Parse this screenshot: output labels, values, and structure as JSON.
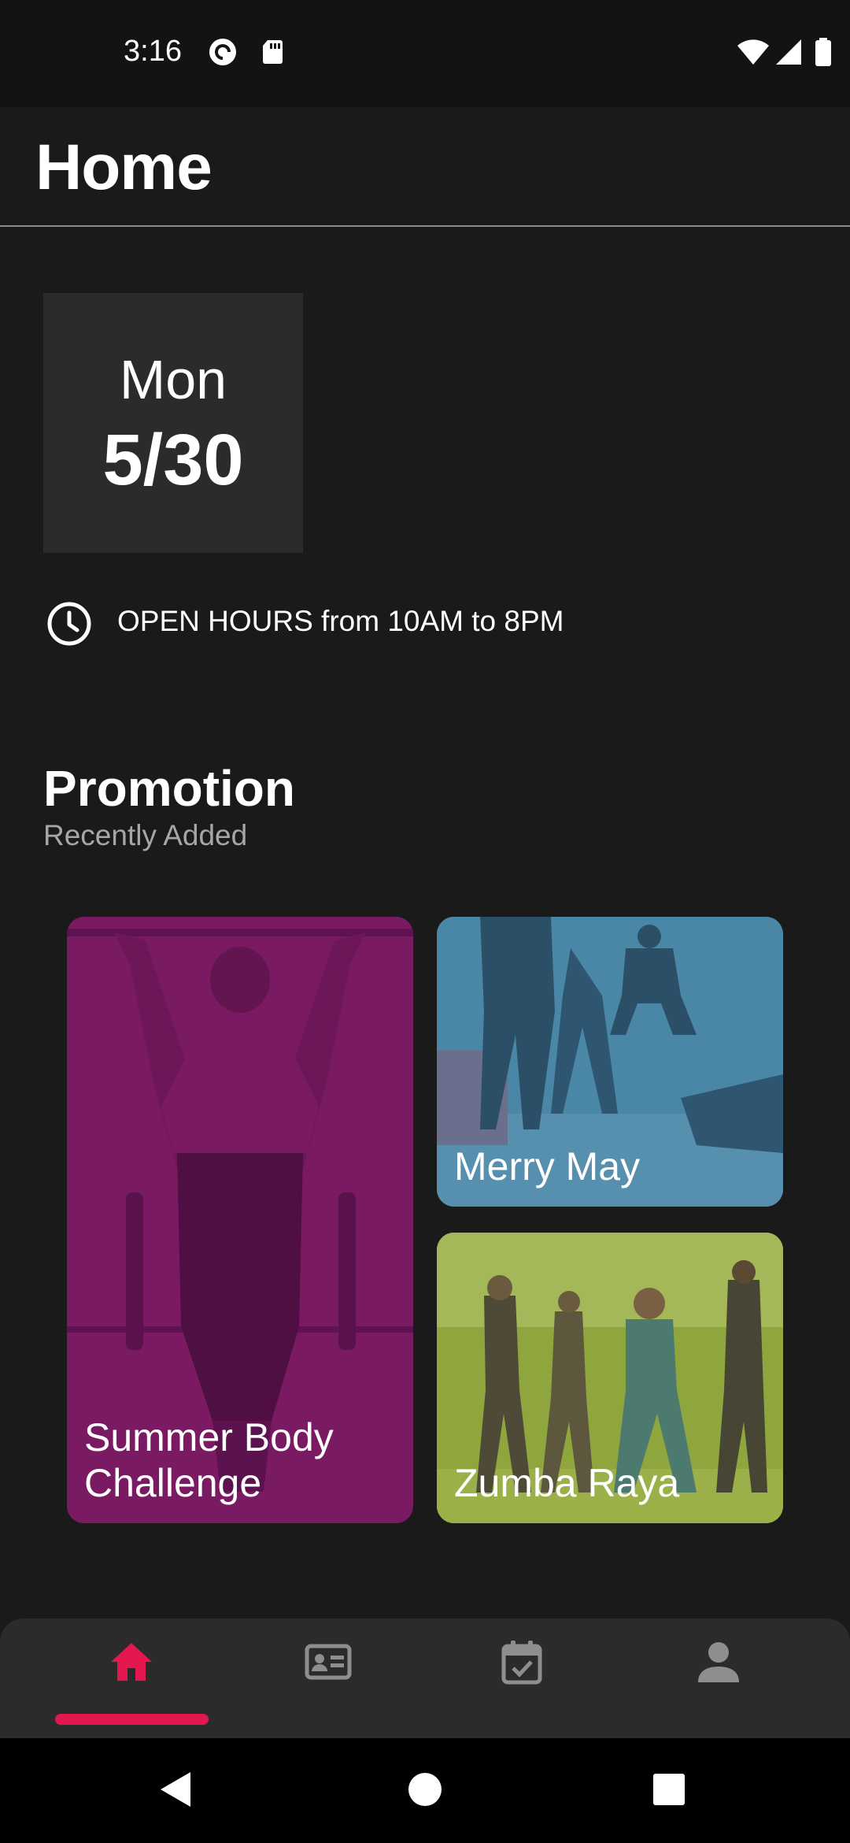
{
  "status_bar": {
    "time": "3:16",
    "icons_left": [
      "pocket-casts-icon",
      "sd-card-icon"
    ],
    "icons_right": [
      "wifi-icon",
      "cell-signal-icon",
      "battery-icon"
    ]
  },
  "app_bar": {
    "title": "Home"
  },
  "date_card": {
    "day": "Mon",
    "date": "5/30"
  },
  "hours": {
    "icon": "clock-icon",
    "text": "OPEN HOURS from 10AM to 8PM"
  },
  "promotion": {
    "title": "Promotion",
    "subtitle": "Recently Added",
    "cards": [
      {
        "label": "Summer Body Challenge",
        "overlay_color": "#7a1a63"
      },
      {
        "label": "Merry May",
        "overlay_color": "#4a86a6"
      },
      {
        "label": "Zumba Raya",
        "overlay_color": "#8fa53d"
      }
    ]
  },
  "bottom_nav": {
    "items": [
      {
        "icon": "home-icon",
        "active": true
      },
      {
        "icon": "id-card-icon",
        "active": false
      },
      {
        "icon": "calendar-check-icon",
        "active": false
      },
      {
        "icon": "person-icon",
        "active": false
      }
    ],
    "active_color": "#e5174f",
    "inactive_color": "#8e8e8e"
  },
  "system_nav": {
    "icons": [
      "back-icon",
      "home-circle-icon",
      "recents-icon"
    ]
  }
}
